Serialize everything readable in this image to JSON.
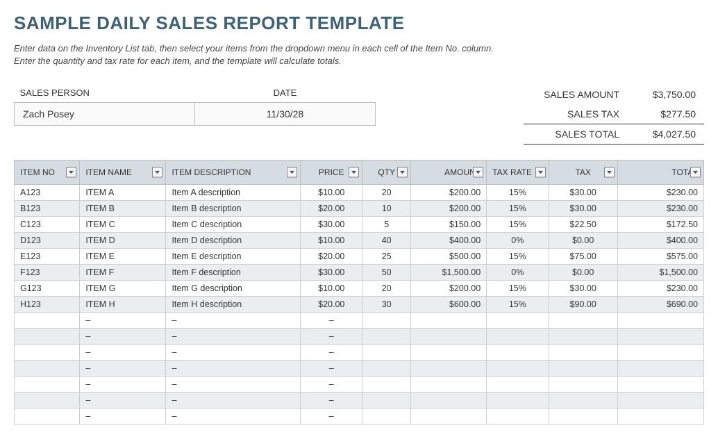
{
  "title": "SAMPLE DAILY SALES REPORT TEMPLATE",
  "instructions_line1": "Enter data on the Inventory List tab, then select your items from the dropdown menu in each cell of the Item No. column.",
  "instructions_line2": "Enter the quantity and tax rate for each item, and the template will calculate totals.",
  "person_date": {
    "sales_person_label": "SALES PERSON",
    "date_label": "DATE",
    "sales_person_value": "Zach Posey",
    "date_value": "11/30/28"
  },
  "summary": {
    "sales_amount_label": "SALES AMOUNT",
    "sales_amount_value": "$3,750.00",
    "sales_tax_label": "SALES TAX",
    "sales_tax_value": "$277.50",
    "sales_total_label": "SALES TOTAL",
    "sales_total_value": "$4,027.50"
  },
  "columns": {
    "item_no": "ITEM NO",
    "item_name": "ITEM NAME",
    "item_description": "ITEM DESCRIPTION",
    "price": "PRICE",
    "qty": "QTY",
    "amount": "AMOUNT",
    "tax_rate": "TAX RATE",
    "tax": "TAX",
    "total": "TOTAL"
  },
  "rows": [
    {
      "item_no": "A123",
      "item_name": "ITEM A",
      "desc": "Item A description",
      "price": "$10.00",
      "qty": "20",
      "amount": "$200.00",
      "tax_rate": "15%",
      "tax": "$30.00",
      "total": "$230.00"
    },
    {
      "item_no": "B123",
      "item_name": "ITEM B",
      "desc": "Item B description",
      "price": "$20.00",
      "qty": "10",
      "amount": "$200.00",
      "tax_rate": "15%",
      "tax": "$30.00",
      "total": "$230.00"
    },
    {
      "item_no": "C123",
      "item_name": "ITEM C",
      "desc": "Item C description",
      "price": "$30.00",
      "qty": "5",
      "amount": "$150.00",
      "tax_rate": "15%",
      "tax": "$22.50",
      "total": "$172.50"
    },
    {
      "item_no": "D123",
      "item_name": "ITEM D",
      "desc": "Item D description",
      "price": "$10.00",
      "qty": "40",
      "amount": "$400.00",
      "tax_rate": "0%",
      "tax": "$0.00",
      "total": "$400.00"
    },
    {
      "item_no": "E123",
      "item_name": "ITEM E",
      "desc": "Item E description",
      "price": "$20.00",
      "qty": "25",
      "amount": "$500.00",
      "tax_rate": "15%",
      "tax": "$75.00",
      "total": "$575.00"
    },
    {
      "item_no": "F123",
      "item_name": "ITEM F",
      "desc": "Item F description",
      "price": "$30.00",
      "qty": "50",
      "amount": "$1,500.00",
      "tax_rate": "0%",
      "tax": "$0.00",
      "total": "$1,500.00"
    },
    {
      "item_no": "G123",
      "item_name": "ITEM G",
      "desc": "Item G description",
      "price": "$10.00",
      "qty": "20",
      "amount": "$200.00",
      "tax_rate": "15%",
      "tax": "$30.00",
      "total": "$230.00"
    },
    {
      "item_no": "H123",
      "item_name": "ITEM H",
      "desc": "Item H description",
      "price": "$20.00",
      "qty": "30",
      "amount": "$600.00",
      "tax_rate": "15%",
      "tax": "$90.00",
      "total": "$690.00"
    },
    {
      "item_no": "",
      "item_name": "–",
      "desc": "–",
      "price": "–",
      "qty": "",
      "amount": "",
      "tax_rate": "",
      "tax": "",
      "total": ""
    },
    {
      "item_no": "",
      "item_name": "–",
      "desc": "–",
      "price": "–",
      "qty": "",
      "amount": "",
      "tax_rate": "",
      "tax": "",
      "total": ""
    },
    {
      "item_no": "",
      "item_name": "–",
      "desc": "–",
      "price": "–",
      "qty": "",
      "amount": "",
      "tax_rate": "",
      "tax": "",
      "total": ""
    },
    {
      "item_no": "",
      "item_name": "–",
      "desc": "–",
      "price": "–",
      "qty": "",
      "amount": "",
      "tax_rate": "",
      "tax": "",
      "total": ""
    },
    {
      "item_no": "",
      "item_name": "–",
      "desc": "–",
      "price": "–",
      "qty": "",
      "amount": "",
      "tax_rate": "",
      "tax": "",
      "total": ""
    },
    {
      "item_no": "",
      "item_name": "–",
      "desc": "–",
      "price": "–",
      "qty": "",
      "amount": "",
      "tax_rate": "",
      "tax": "",
      "total": ""
    },
    {
      "item_no": "",
      "item_name": "–",
      "desc": "–",
      "price": "–",
      "qty": "",
      "amount": "",
      "tax_rate": "",
      "tax": "",
      "total": ""
    }
  ]
}
